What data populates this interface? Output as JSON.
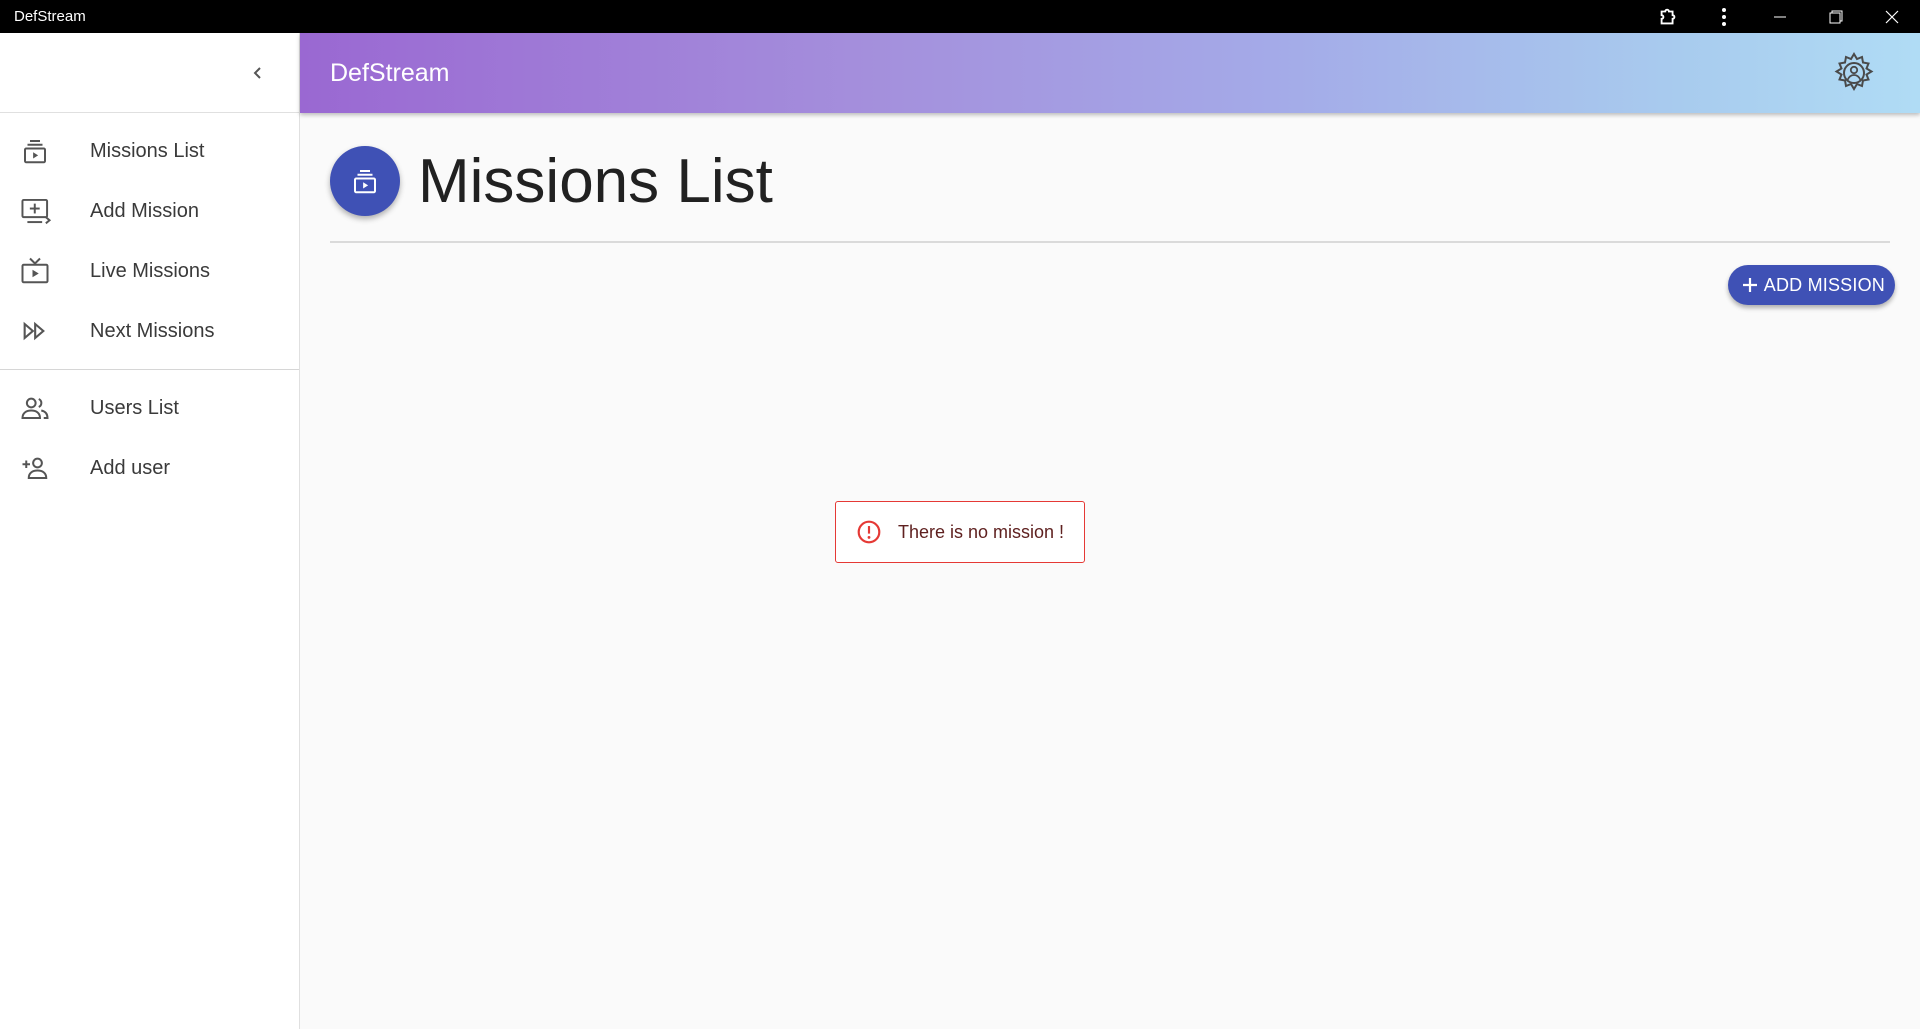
{
  "window": {
    "title": "DefStream"
  },
  "sidebar": {
    "primary_items": [
      {
        "label": "Missions List",
        "icon": "missions-list-icon"
      },
      {
        "label": "Add Mission",
        "icon": "add-mission-icon"
      },
      {
        "label": "Live Missions",
        "icon": "live-missions-icon"
      },
      {
        "label": "Next Missions",
        "icon": "next-missions-icon"
      }
    ],
    "secondary_items": [
      {
        "label": "Users List",
        "icon": "users-list-icon"
      },
      {
        "label": "Add user",
        "icon": "add-user-icon"
      }
    ]
  },
  "header": {
    "brand": "DefStream"
  },
  "main": {
    "page_title": "Missions List",
    "add_button_label": "ADD MISSION",
    "empty_message": "There is no mission !"
  },
  "colors": {
    "primary": "#3f51b5",
    "alert_border": "#e53935",
    "gradient_start": "#9a68d2",
    "gradient_end": "#b0dcf5"
  }
}
